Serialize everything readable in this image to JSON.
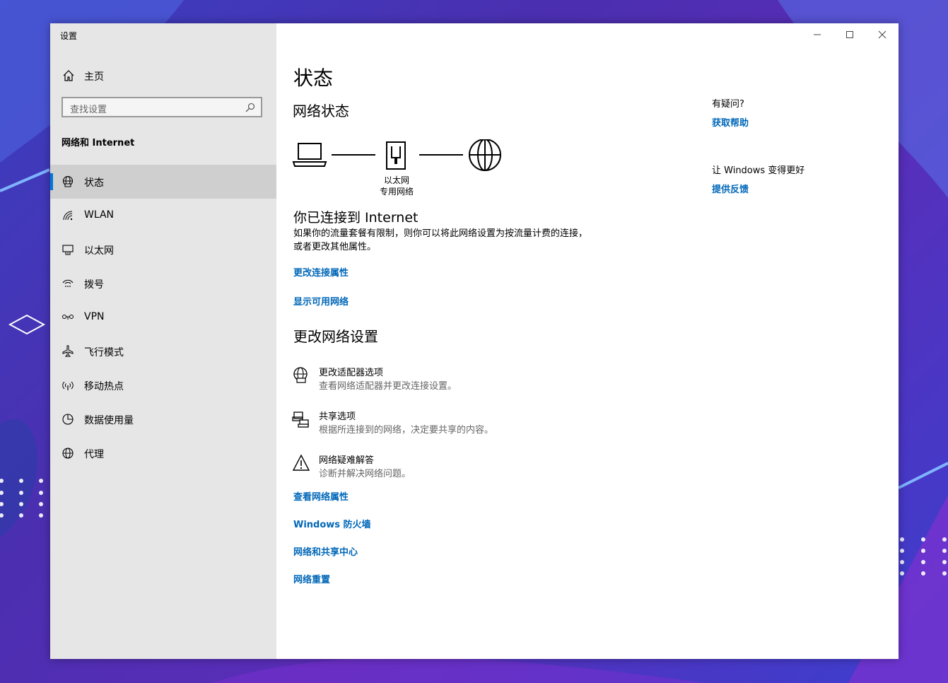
{
  "window": {
    "title": "设置"
  },
  "sidebar": {
    "home": "主页",
    "search_placeholder": "查找设置",
    "section": "网络和 Internet",
    "items": [
      {
        "label": "状态",
        "icon": "globe-monitor-icon",
        "active": true
      },
      {
        "label": "WLAN",
        "icon": "wifi-icon",
        "active": false
      },
      {
        "label": "以太网",
        "icon": "ethernet-icon",
        "active": false
      },
      {
        "label": "拨号",
        "icon": "dialup-icon",
        "active": false
      },
      {
        "label": "VPN",
        "icon": "vpn-icon",
        "active": false
      },
      {
        "label": "飞行模式",
        "icon": "airplane-icon",
        "active": false
      },
      {
        "label": "移动热点",
        "icon": "hotspot-icon",
        "active": false
      },
      {
        "label": "数据使用量",
        "icon": "data-usage-icon",
        "active": false
      },
      {
        "label": "代理",
        "icon": "globe-icon",
        "active": false
      }
    ]
  },
  "main": {
    "title": "状态",
    "network_status_heading": "网络状态",
    "diagram": {
      "adapter_label_1": "以太网",
      "adapter_label_2": "专用网络"
    },
    "connected_title": "你已连接到 Internet",
    "connected_desc": "如果你的流量套餐有限制，则你可以将此网络设置为按流量计费的连接，或者更改其他属性。",
    "link_change_props": "更改连接属性",
    "link_show_networks": "显示可用网络",
    "change_settings_heading": "更改网络设置",
    "options": [
      {
        "title": "更改适配器选项",
        "desc": "查看网络适配器并更改连接设置。",
        "icon": "adapter-globe-icon"
      },
      {
        "title": "共享选项",
        "desc": "根据所连接到的网络，决定要共享的内容。",
        "icon": "sharing-icon"
      },
      {
        "title": "网络疑难解答",
        "desc": "诊断并解决网络问题。",
        "icon": "warning-icon"
      }
    ],
    "links": [
      "查看网络属性",
      "Windows 防火墙",
      "网络和共享中心",
      "网络重置"
    ]
  },
  "aside": {
    "question": "有疑问?",
    "help_link": "获取帮助",
    "improve": "让 Windows 变得更好",
    "feedback_link": "提供反馈"
  },
  "colors": {
    "accent": "#0078d7",
    "link": "#0067b8",
    "sidebar_bg": "#e6e6e6",
    "active_bg": "#cfcfcf"
  }
}
